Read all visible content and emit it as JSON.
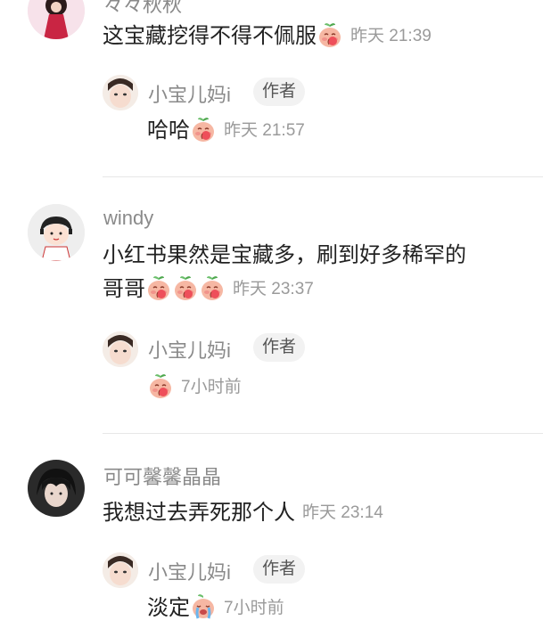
{
  "comments": [
    {
      "username": "々々秋秋",
      "text": "这宝藏挖得不得不佩服",
      "time": "昨天 21:39",
      "reply": {
        "username": "小宝儿妈i",
        "badge": "作者",
        "text": "哈哈",
        "time": "昨天 21:57"
      }
    },
    {
      "username": "windy",
      "text_line1": "小红书果然是宝藏多，刷到好多稀罕的",
      "text_line2": "哥哥",
      "time": "昨天 23:37",
      "reply": {
        "username": "小宝儿妈i",
        "badge": "作者",
        "text": "",
        "time": "7小时前"
      }
    },
    {
      "username": "可可馨馨晶晶",
      "text": "我想过去弄死那个人",
      "time": "昨天 23:14",
      "reply": {
        "username": "小宝儿妈i",
        "badge": "作者",
        "text": "淡定",
        "time": "7小时前"
      }
    }
  ],
  "icons": {
    "emoji_peach": "peach-face-emoji-icon",
    "emoji_cry": "crying-face-emoji-icon"
  },
  "colors": {
    "text": "#222222",
    "muted": "#8a8a8a",
    "badge_bg": "#f2f2f2",
    "divider": "#e7e7e7"
  }
}
